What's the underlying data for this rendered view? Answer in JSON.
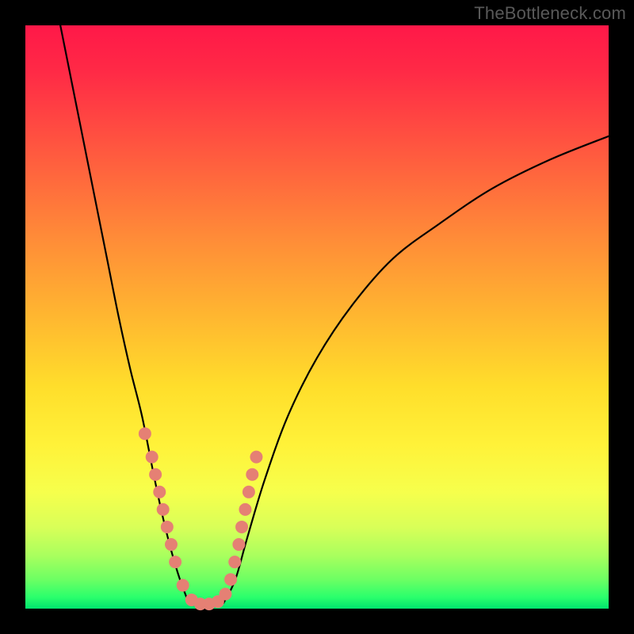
{
  "watermark": "TheBottleneck.com",
  "chart_data": {
    "type": "line",
    "title": "",
    "xlabel": "",
    "ylabel": "",
    "xlim": [
      0,
      100
    ],
    "ylim": [
      0,
      100
    ],
    "grid": false,
    "legend": false,
    "gradient_meaning": "vertical background color encodes bottleneck severity (red high, green low)",
    "series": [
      {
        "name": "bottleneck-curve-left",
        "x": [
          6,
          8,
          10,
          12,
          14,
          16,
          18,
          20,
          22,
          23.5,
          25,
          26.5,
          28
        ],
        "y": [
          100,
          90,
          80,
          70,
          60,
          50,
          41,
          33,
          23,
          16,
          10,
          5,
          1
        ]
      },
      {
        "name": "bottleneck-flat",
        "x": [
          28,
          30,
          32,
          34
        ],
        "y": [
          1,
          0.5,
          0.5,
          1
        ]
      },
      {
        "name": "bottleneck-curve-right",
        "x": [
          34,
          36,
          38,
          41,
          45,
          50,
          56,
          63,
          71,
          80,
          90,
          100
        ],
        "y": [
          1,
          5,
          12,
          22,
          33,
          43,
          52,
          60,
          66,
          72,
          77,
          81
        ]
      }
    ],
    "highlight_points": {
      "name": "highlighted-gpu-points",
      "comment": "salmon dots on the curve in the low-bottleneck band (roughly y in 3..30)",
      "x": [
        20.5,
        21.7,
        22.3,
        23.0,
        23.6,
        24.3,
        25.0,
        25.7,
        27.0,
        28.5,
        30.0,
        31.5,
        33.0,
        34.3,
        35.2,
        35.9,
        36.6,
        37.1,
        37.7,
        38.3,
        38.9,
        39.6
      ],
      "y": [
        30,
        26,
        23,
        20,
        17,
        14,
        11,
        8,
        4,
        1.5,
        0.8,
        0.8,
        1.2,
        2.5,
        5,
        8,
        11,
        14,
        17,
        20,
        23,
        26
      ]
    }
  }
}
